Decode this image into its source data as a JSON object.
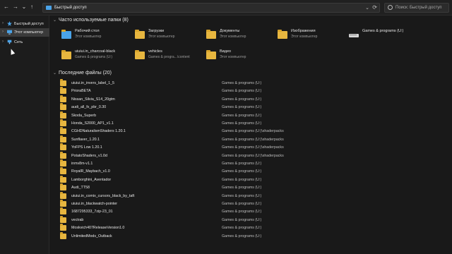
{
  "nav": {
    "back": "←",
    "forward": "→",
    "recent": "⌄",
    "up": "↑"
  },
  "address": {
    "path": "Быстрый доступ",
    "chevron": "⌄",
    "refresh": "⟳"
  },
  "search": {
    "placeholder": "Поиск: Быстрый доступ"
  },
  "sidebar": {
    "items": [
      {
        "label": "Быстрый доступ",
        "icon": "star-icon"
      },
      {
        "label": "Этот компьютер",
        "icon": "computer-icon"
      },
      {
        "label": "Сеть",
        "icon": "network-icon"
      }
    ]
  },
  "frequent": {
    "header": "Часто используемые папки (8)",
    "tiles": [
      {
        "name": "Рабочий стол",
        "sub": "Этот компьютер",
        "icon": "desktop-folder-icon"
      },
      {
        "name": "Загрузки",
        "sub": "Этот компьютер",
        "icon": "downloads-folder-icon"
      },
      {
        "name": "Документы",
        "sub": "Этот компьютер",
        "icon": "documents-folder-icon"
      },
      {
        "name": "Изображения",
        "sub": "Этот компьютер",
        "icon": "pictures-folder-icon"
      },
      {
        "name": "Games & programs  (U:)",
        "sub": "",
        "icon": "drive-icon"
      },
      {
        "name": "uiuiui.in_charcoal-black",
        "sub": "Games & programs  (U:)",
        "icon": "folder-icon"
      },
      {
        "name": "vehicles",
        "sub": "Games & progra...\\content",
        "icon": "folder-icon"
      },
      {
        "name": "Видео",
        "sub": "Этот компьютер",
        "icon": "videos-folder-icon"
      }
    ]
  },
  "recent": {
    "header": "Последние файлы (20)",
    "files": [
      {
        "name": "uiuiui.in_invers_label_1_5",
        "location": "Games & programs  (U:)"
      },
      {
        "name": "PrioraBETA",
        "location": "Games & programs  (U:)"
      },
      {
        "name": "Nissan_Silvia_S14_20gtm",
        "location": "Games & programs  (U:)"
      },
      {
        "name": "audi_all_fx_pbr_0.30",
        "location": "Games & programs  (U:)"
      },
      {
        "name": "Skoda_Superb",
        "location": "Games & programs  (U:)"
      },
      {
        "name": "Honda_S2000_AP1_v1.1",
        "location": "Games & programs  (U:)"
      },
      {
        "name": "CGHDNaturalismShaders 1.20.1",
        "location": "Games & programs  (U:)\\shaderpacks"
      },
      {
        "name": "Sunflaver_1.20.1",
        "location": "Games & programs  (U:)\\shaderpacks"
      },
      {
        "name": "YoFPS Low 1.20.1",
        "location": "Games & programs  (U:)\\shaderpacks"
      },
      {
        "name": "PotatoShaders_v1.0d",
        "location": "Games & programs  (U:)\\shaderpacks"
      },
      {
        "name": "inmv8m-v1.1",
        "location": "Games & programs  (U:)"
      },
      {
        "name": "RoyalR_Maybach_v1.0",
        "location": "Games & programs  (U:)"
      },
      {
        "name": "Lamborghini_Aventador",
        "location": "Games & programs  (U:)"
      },
      {
        "name": "Audi_TT58",
        "location": "Games & programs  (U:)"
      },
      {
        "name": "uiuiui.in_comix_cursors_black_by_taft",
        "location": "Games & programs  (U:)"
      },
      {
        "name": "uiuiui.in_blackwatch-pointer",
        "location": "Games & programs  (U:)"
      },
      {
        "name": "1687295333_7zip-23_01",
        "location": "Games & programs  (U:)"
      },
      {
        "name": "vectrab",
        "location": "Games & programs  (U:)"
      },
      {
        "name": "Moskvich407ReleaseVersion1.0",
        "location": "Games & programs  (U:)"
      },
      {
        "name": "UnlimitedMods_Outback",
        "location": "Games & programs  (U:)"
      }
    ]
  },
  "colors": {
    "folder": "#e7b63f",
    "accent": "#4aa3e8",
    "background": "#191919"
  }
}
